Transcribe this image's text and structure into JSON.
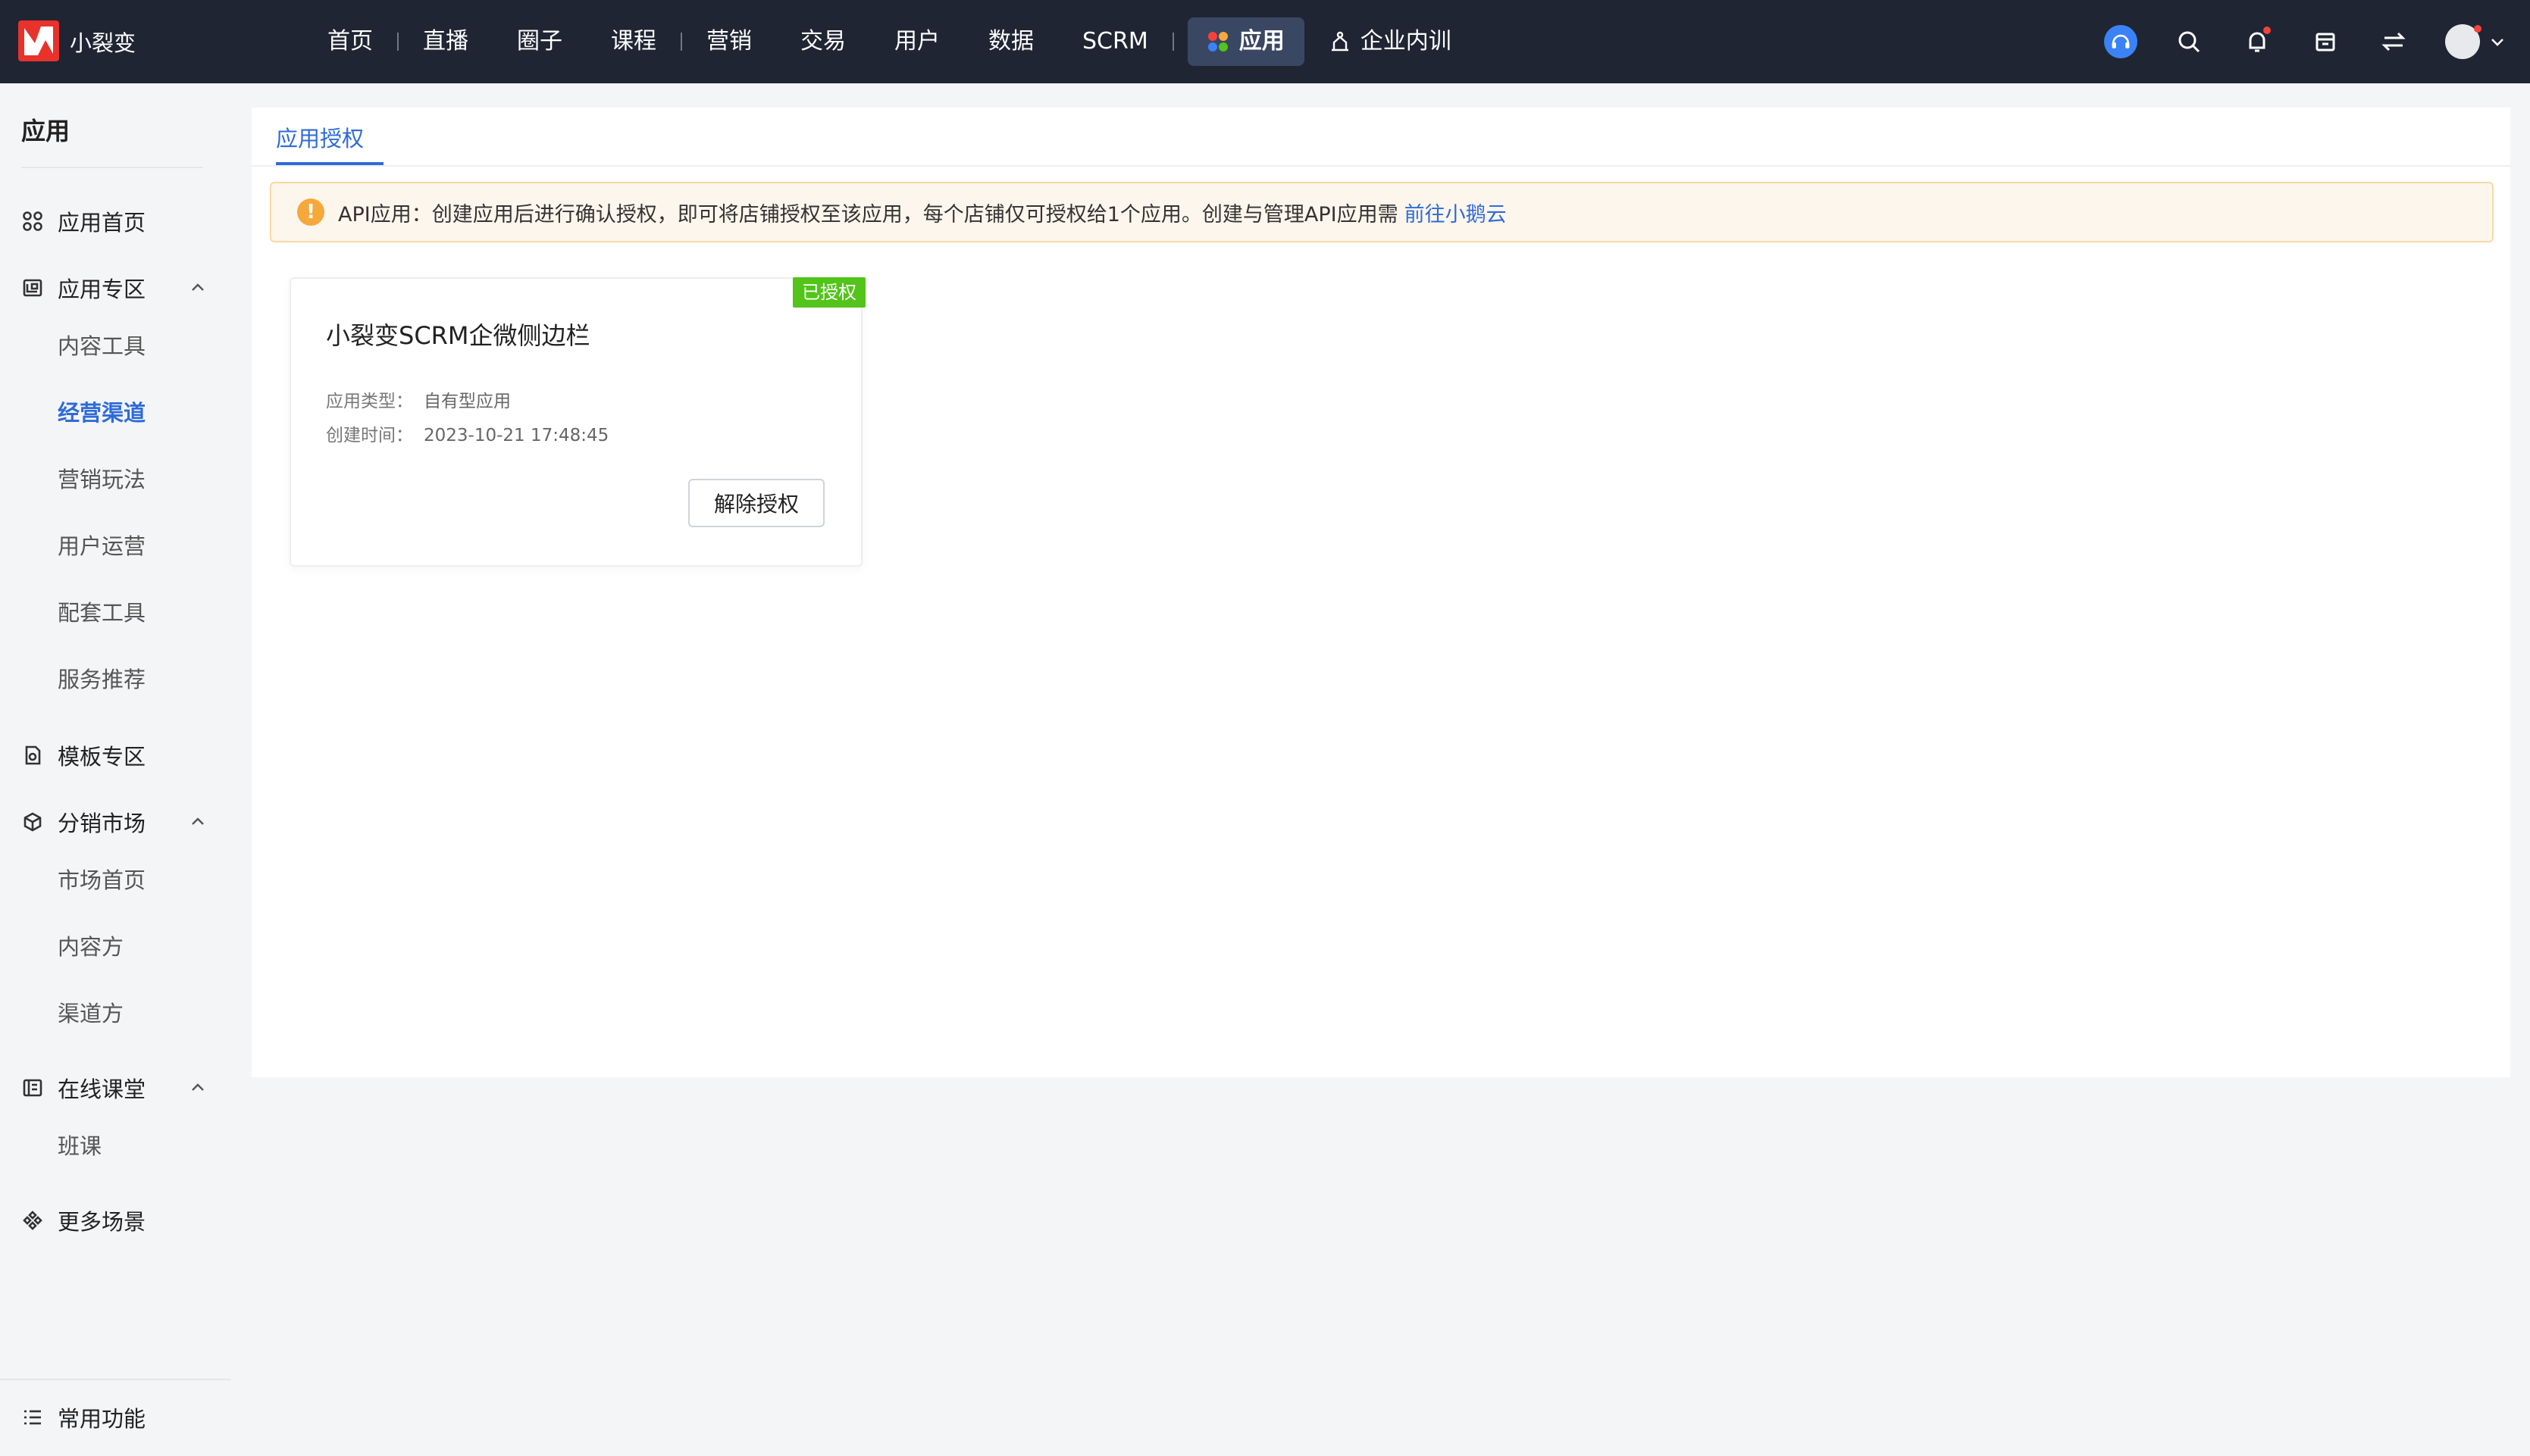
{
  "brand": {
    "name": "小裂变"
  },
  "nav": {
    "items": [
      {
        "label": "首页"
      },
      {
        "label": "直播"
      },
      {
        "label": "圈子"
      },
      {
        "label": "课程"
      },
      {
        "label": "营销"
      },
      {
        "label": "交易"
      },
      {
        "label": "用户"
      },
      {
        "label": "数据"
      },
      {
        "label": "SCRM"
      }
    ],
    "active": {
      "label": "应用"
    },
    "extra": {
      "label": "企业内训"
    }
  },
  "header_icons": [
    "headset-icon",
    "search-icon",
    "bell-icon",
    "store-icon",
    "switch-icon",
    "avatar"
  ],
  "sidebar": {
    "title": "应用",
    "groups": [
      {
        "label": "应用首页",
        "icon": "grid-icon"
      },
      {
        "label": "应用专区",
        "icon": "app-zone-icon",
        "children": [
          "内容工具",
          "经营渠道",
          "营销玩法",
          "用户运营",
          "配套工具",
          "服务推荐"
        ],
        "active_child": "经营渠道"
      },
      {
        "label": "模板专区",
        "icon": "template-icon"
      },
      {
        "label": "分销市场",
        "icon": "cube-icon",
        "children": [
          "市场首页",
          "内容方",
          "渠道方"
        ]
      },
      {
        "label": "在线课堂",
        "icon": "classroom-icon",
        "children": [
          "班课"
        ]
      },
      {
        "label": "更多场景",
        "icon": "scenes-icon"
      }
    ],
    "bottom": {
      "label": "常用功能",
      "icon": "list-icon"
    }
  },
  "main": {
    "tab": "应用授权",
    "alert": {
      "text": "API应用：创建应用后进行确认授权，即可将店铺授权至该应用，每个店铺仅可授权给1个应用。创建与管理API应用需",
      "link": "前往小鹅云"
    },
    "card": {
      "badge": "已授权",
      "title": "小裂变SCRM企微侧边栏",
      "type_label": "应用类型：",
      "type_value": "自有型应用",
      "time_label": "创建时间：",
      "time_value": "2023-10-21 17:48:45",
      "button": "解除授权"
    }
  },
  "colors": {
    "accent": "#2f6bd9",
    "topbar": "#1f2533",
    "badge": "#52c41a",
    "alert_bg": "#fdf6ec",
    "alert_icon": "#f5a93c"
  }
}
